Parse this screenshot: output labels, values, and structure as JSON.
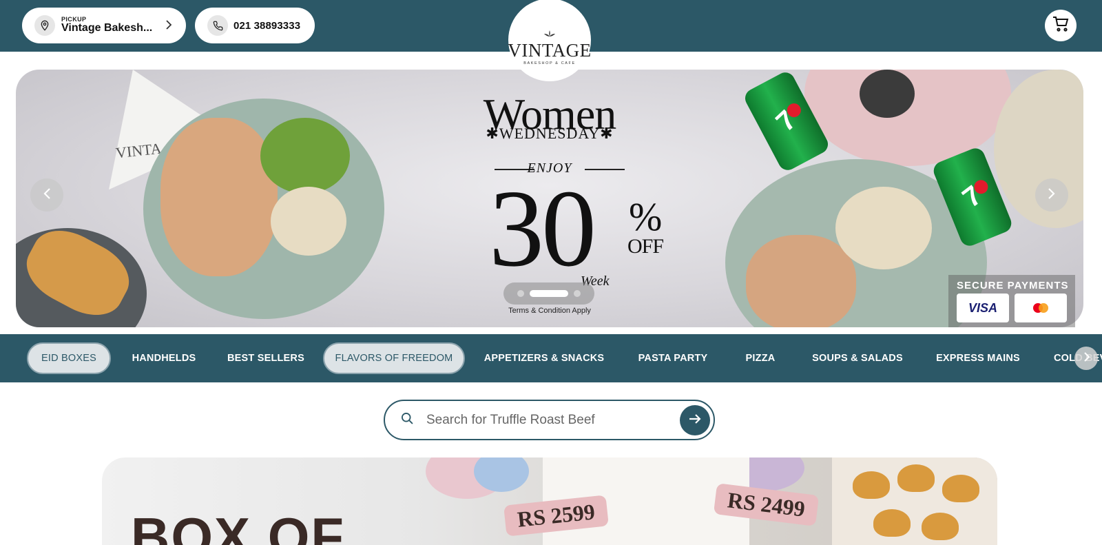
{
  "header": {
    "pickup_label": "PICKUP",
    "pickup_location": "Vintage Bakesh...",
    "phone": "021 38893333",
    "logo_word": "VINTAGE",
    "logo_sub": "BAKESHOP & CAFE"
  },
  "banner": {
    "headline": "Women",
    "subheadline": "✱WEDNESDAY✱",
    "enjoy": "ENJOY",
    "discount_number": "30",
    "discount_pct": "%",
    "discount_off": "OFF",
    "week_text": "Week",
    "terms": "Terms & Condition Apply",
    "napkin_text": "VINTA",
    "can_label": "7",
    "secure_title": "SECURE PAYMENTS",
    "visa": "VISA",
    "slides_total": 3,
    "slide_active": 2
  },
  "categories": [
    {
      "label": "EID BOXES",
      "selected": true
    },
    {
      "label": "HANDHELDS",
      "selected": false
    },
    {
      "label": "BEST SELLERS",
      "selected": false
    },
    {
      "label": "FLAVORS OF FREEDOM",
      "selected": true
    },
    {
      "label": "APPETIZERS & SNACKS",
      "selected": false
    },
    {
      "label": "PASTA PARTY",
      "selected": false
    },
    {
      "label": "PIZZA",
      "selected": false
    },
    {
      "label": "SOUPS & SALADS",
      "selected": false
    },
    {
      "label": "EXPRESS MAINS",
      "selected": false
    },
    {
      "label": "COLD BEV",
      "selected": false
    }
  ],
  "search": {
    "placeholder": "Search for Truffle Roast Beef",
    "value": ""
  },
  "promo": {
    "title": "BOX OF",
    "price_1": "RS 2599",
    "price_2": "RS 2499"
  },
  "colors": {
    "brand_teal": "#2c5867",
    "white": "#ffffff"
  }
}
